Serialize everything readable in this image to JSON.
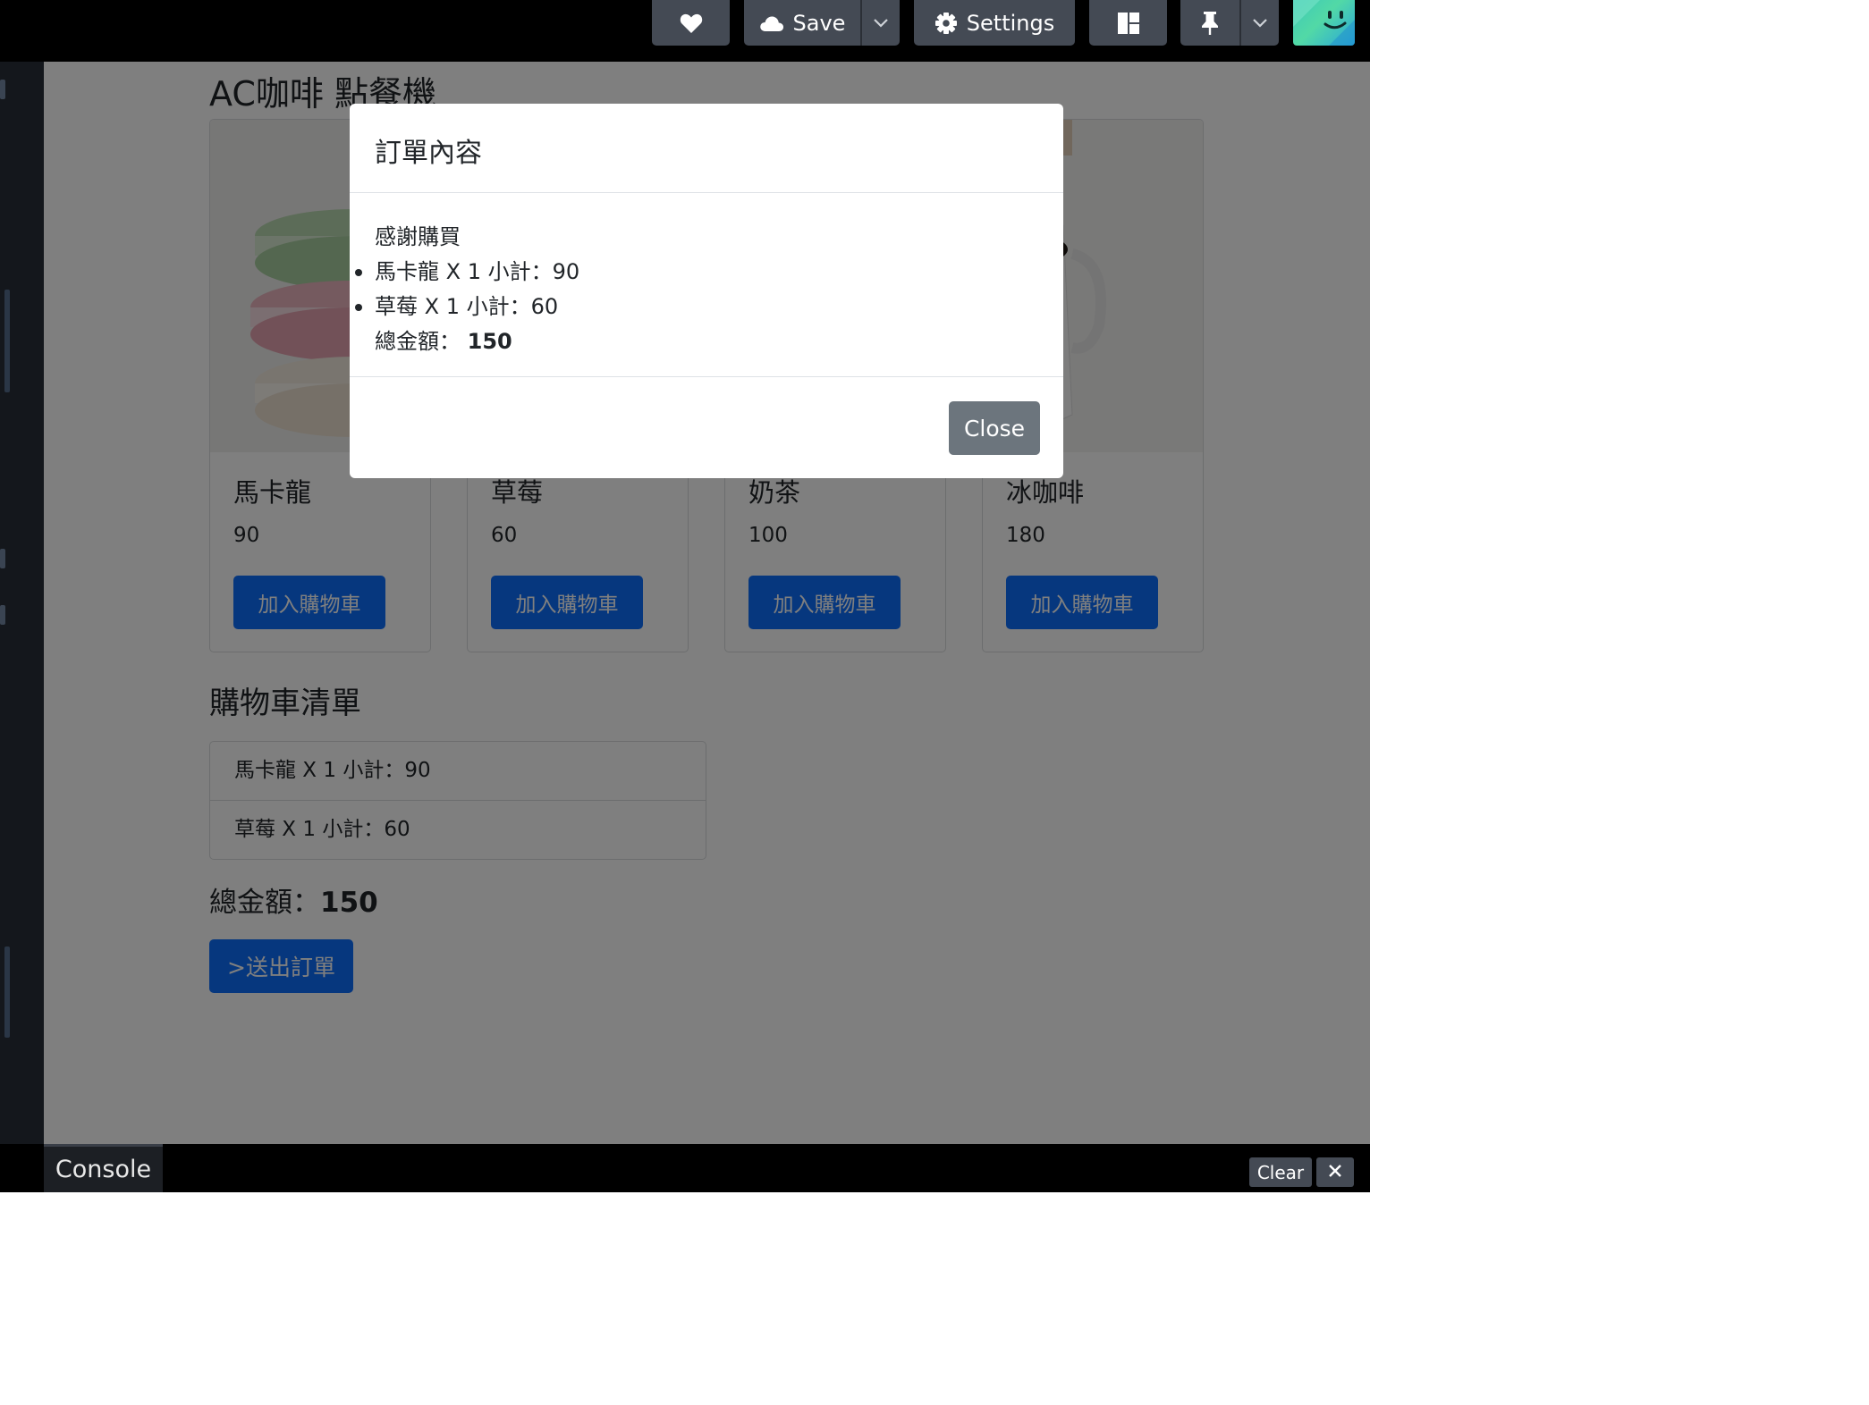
{
  "toolbar": {
    "save_label": "Save",
    "settings_label": "Settings"
  },
  "app": {
    "title": "AC咖啡 點餐機",
    "products": [
      {
        "name": "馬卡龍",
        "price": "90",
        "button": "加入購物車"
      },
      {
        "name": "草莓",
        "price": "60",
        "button": "加入購物車"
      },
      {
        "name": "奶茶",
        "price": "100",
        "button": "加入購物車"
      },
      {
        "name": "冰咖啡",
        "price": "180",
        "button": "加入購物車"
      }
    ],
    "cart": {
      "title": "購物車清單",
      "items": [
        "馬卡龍 X 1 小計：90",
        "草莓 X 1 小計：60"
      ],
      "total_label": "總金額：",
      "total_value": "150",
      "submit_label": ">送出訂單"
    }
  },
  "modal": {
    "title": "訂單內容",
    "thanks": "感謝購買",
    "items": [
      "馬卡龍 X 1 小計：90",
      "草莓 X 1 小計：60"
    ],
    "total_label": "總金額：",
    "total_value": "150",
    "close_label": "Close"
  },
  "console": {
    "tab_label": "Console",
    "clear_label": "Clear"
  }
}
